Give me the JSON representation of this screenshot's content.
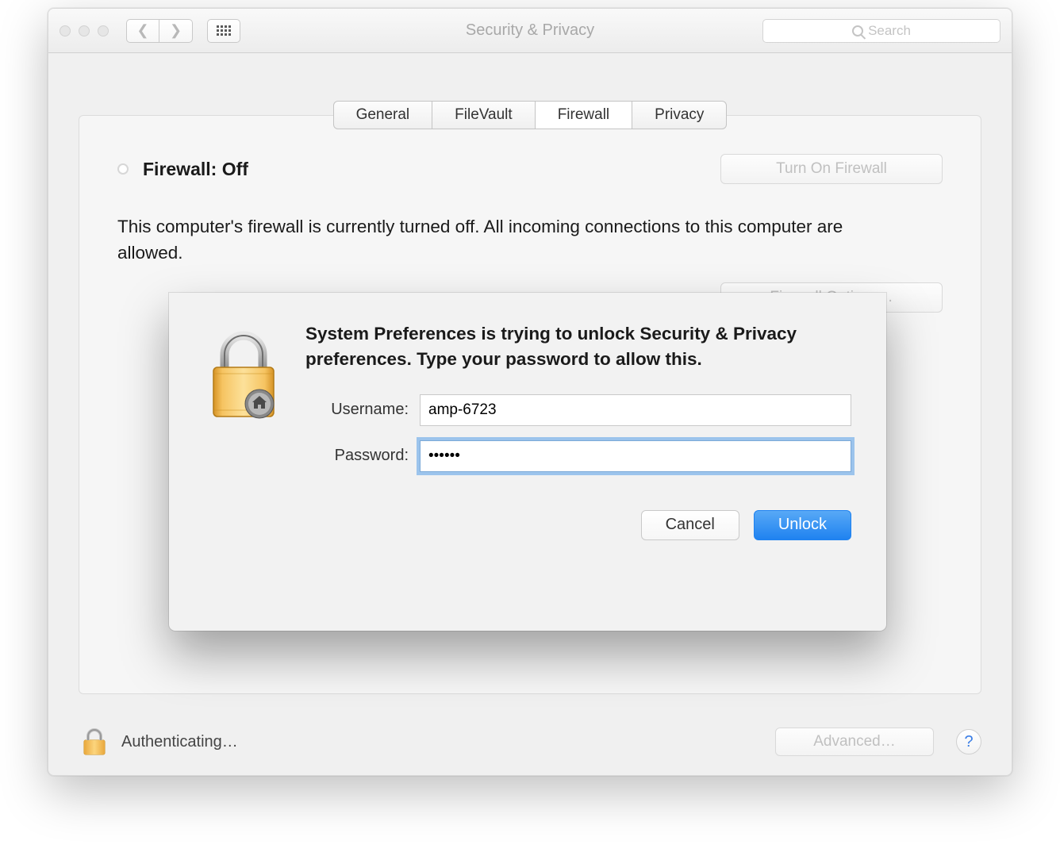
{
  "window": {
    "title": "Security & Privacy",
    "search_placeholder": "Search"
  },
  "tabs": {
    "general": "General",
    "filevault": "FileVault",
    "firewall": "Firewall",
    "privacy": "Privacy",
    "active": "firewall"
  },
  "firewall": {
    "status_label": "Firewall: Off",
    "turn_on_label": "Turn On Firewall",
    "description": "This computer's firewall is currently turned off. All incoming connections to this computer are allowed.",
    "options_label": "Firewall Options…"
  },
  "footer": {
    "auth_status": "Authenticating…",
    "advanced_label": "Advanced…",
    "help_label": "?"
  },
  "dialog": {
    "message": "System Preferences is trying to unlock Security & Privacy preferences. Type your password to allow this.",
    "username_label": "Username:",
    "password_label": "Password:",
    "username_value": "amp-6723",
    "password_value": "••••••",
    "cancel_label": "Cancel",
    "unlock_label": "Unlock"
  }
}
